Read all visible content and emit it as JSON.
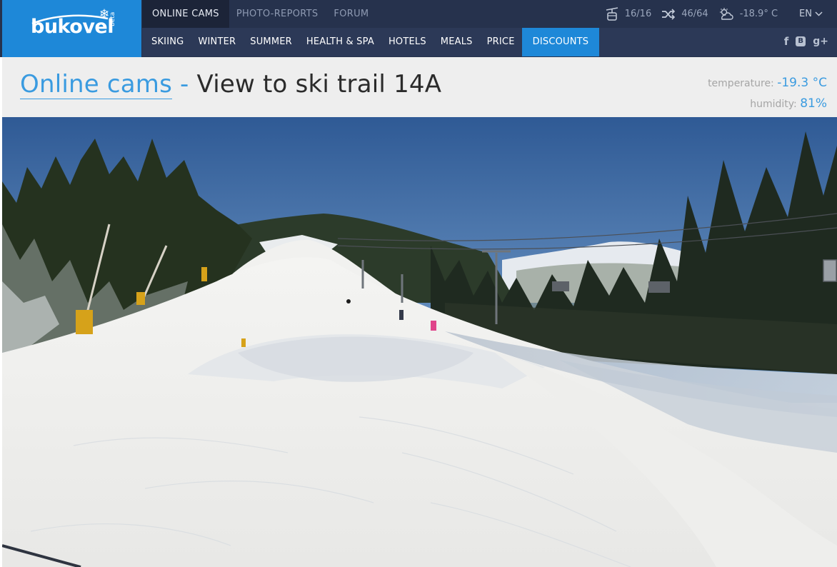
{
  "logo": {
    "brand": "bukovel",
    "beta": "beta"
  },
  "topnav": {
    "items": [
      "ONLINE CAMS",
      "PHOTO-REPORTS",
      "FORUM"
    ],
    "active": 0
  },
  "mainnav": {
    "items": [
      "SKIING",
      "WINTER",
      "SUMMER",
      "HEALTH & SPA",
      "HOTELS",
      "MEALS",
      "PRICE",
      "DISCOUNTS"
    ]
  },
  "status": {
    "lifts": "16/16",
    "trails": "46/64",
    "weather": "-18.9° C",
    "language": "EN"
  },
  "title": {
    "breadcrumb": "Online cams",
    "separator": " - ",
    "text": "View to ski trail 14A"
  },
  "readings": {
    "temperature_label": "temperature:",
    "temperature_value": "-19.3 °C",
    "humidity_label": "humidity:",
    "humidity_value": "81%"
  },
  "colors": {
    "header_dark": "#26324d",
    "nav": "#2c3957",
    "accent": "#1e88d8",
    "title_bg": "#eeeeee",
    "link": "#3a9be0"
  },
  "icons": [
    "snowflake-icon",
    "gondola-icon",
    "shuffle-icon",
    "cloud-sun-icon",
    "chevron-down-icon",
    "facebook-icon",
    "vk-icon",
    "google-plus-icon"
  ]
}
